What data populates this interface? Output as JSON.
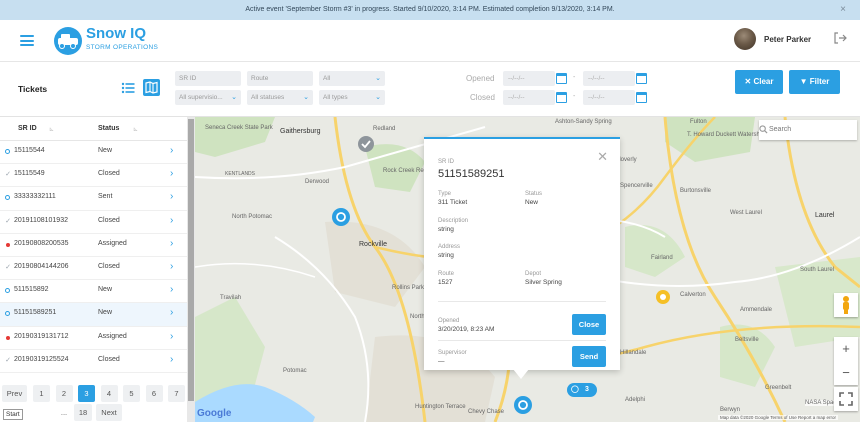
{
  "banner": {
    "text": "Active event 'September Storm #3' in progress. Started 9/10/2020, 3:14 PM. Estimated completion 9/13/2020, 3:14 PM."
  },
  "app": {
    "name": "Snow IQ",
    "subtitle": "STORM OPERATIONS"
  },
  "user": {
    "name": "Peter Parker"
  },
  "page": {
    "title": "Tickets"
  },
  "filters": {
    "sr_id_placeholder": "SR ID",
    "route_placeholder": "Route",
    "all_label": "All",
    "supervisor_label": "All supervisio...",
    "statuses_label": "All statuses",
    "types_label": "All types",
    "opened_label": "Opened",
    "closed_label": "Closed",
    "date_placeholder": "--/--/--",
    "clear_label": "Clear",
    "filter_label": "Filter"
  },
  "list": {
    "col_id": "SR ID",
    "col_status": "Status",
    "rows": [
      {
        "id": "15115544",
        "status": "New",
        "mark": "circle"
      },
      {
        "id": "15115549",
        "status": "Closed",
        "mark": "check"
      },
      {
        "id": "33333332111",
        "status": "Sent",
        "mark": "circle"
      },
      {
        "id": "20191108101932",
        "status": "Closed",
        "mark": "check"
      },
      {
        "id": "20190808200535",
        "status": "Assigned",
        "mark": "dot"
      },
      {
        "id": "20190804144206",
        "status": "Closed",
        "mark": "check"
      },
      {
        "id": "511515892",
        "status": "New",
        "mark": "circle"
      },
      {
        "id": "51151589251",
        "status": "New",
        "mark": "circle"
      },
      {
        "id": "20190319131712",
        "status": "Assigned",
        "mark": "dot"
      },
      {
        "id": "20190319125524",
        "status": "Closed",
        "mark": "check"
      }
    ],
    "active_index": 7
  },
  "pager": {
    "prev": "Prev",
    "pages": [
      "1",
      "2",
      "3",
      "4",
      "5",
      "6",
      "7"
    ],
    "current": "3",
    "ellipsis": "...",
    "last": "18",
    "next": "Next",
    "start_hint": "Start"
  },
  "map": {
    "search_placeholder": "Search",
    "labels": [
      "Seneca Creek State Park",
      "Gaithersburg",
      "Redland",
      "KENTLANDS",
      "Derwood",
      "Rock Creek Regional Park",
      "North Potomac",
      "Rockville",
      "Travilah",
      "Rollins Park",
      "North Bethesda",
      "Potomac",
      "Huntington Terrace",
      "Chevy Chase",
      "Ashton-Sandy Spring",
      "Fulton",
      "T. Howard Duckett Watershed",
      "Burtonsville",
      "Cloverly",
      "West Laurel",
      "Laurel",
      "Fairland",
      "South Laurel",
      "Calverton",
      "Ammendale",
      "Beltsville",
      "Hillandale",
      "Adelphi",
      "Greenbelt",
      "Berwyn",
      "Spencerville",
      "NASA Space Flight"
    ],
    "cluster_count": "3",
    "attribution": "Map data ©2020 Google  Terms of Use  Report a map error",
    "google": "Google"
  },
  "popup": {
    "sr_id_label": "SR ID",
    "sr_id": "51151589251",
    "type_label": "Type",
    "type": "311 Ticket",
    "status_label": "Status",
    "status": "New",
    "description_label": "Description",
    "description": "string",
    "address_label": "Address",
    "address": "string",
    "route_label": "Route",
    "route": "1527",
    "depot_label": "Depot",
    "depot": "Silver Spring",
    "opened_label": "Opened",
    "opened": "3/20/2019, 8:23 AM",
    "close_label": "Close",
    "supervisor_label": "Supervisor",
    "supervisor": "—",
    "send_label": "Send"
  },
  "colors": {
    "accent": "#2b9fe2",
    "assigned": "#e53935",
    "banner": "#c7dff0"
  }
}
